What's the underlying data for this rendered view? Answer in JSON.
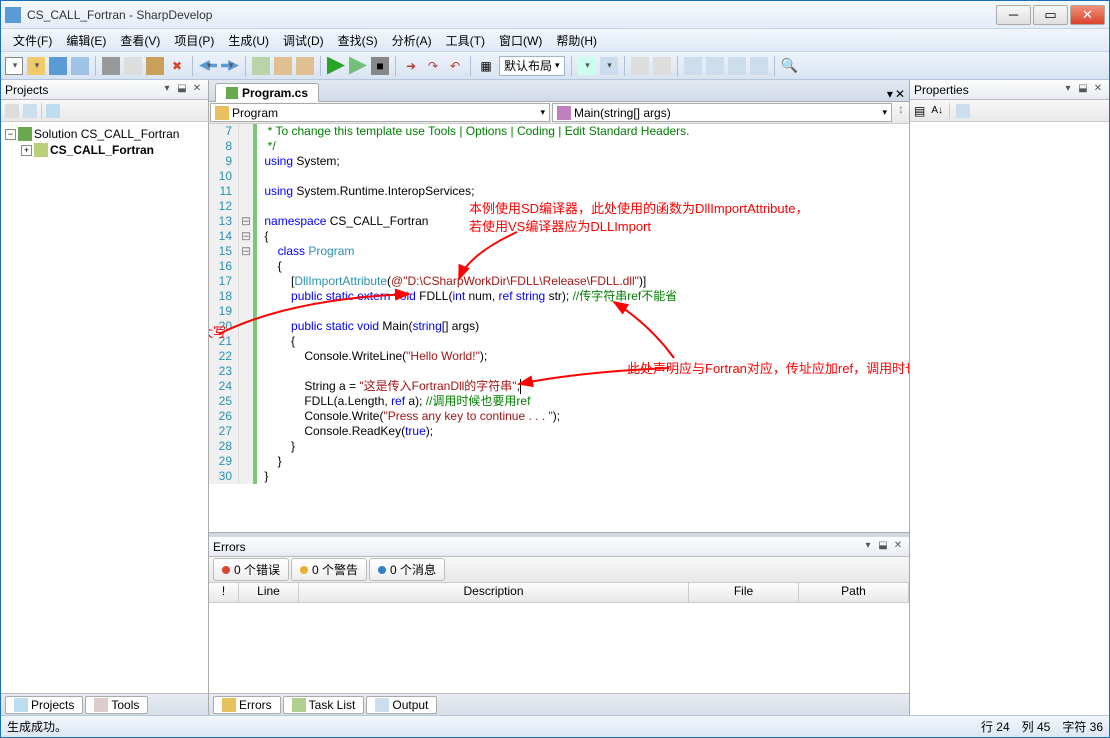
{
  "window": {
    "title": "CS_CALL_Fortran - SharpDevelop"
  },
  "menu": [
    "文件(F)",
    "编辑(E)",
    "查看(V)",
    "项目(P)",
    "生成(U)",
    "调试(D)",
    "查找(S)",
    "分析(A)",
    "工具(T)",
    "窗口(W)",
    "帮助(H)"
  ],
  "layout_combo": "默认布局",
  "projects": {
    "title": "Projects",
    "solution": "Solution CS_CALL_Fortran",
    "project": "CS_CALL_Fortran"
  },
  "tabs": {
    "active": "Program.cs",
    "nav_left": "Program",
    "nav_right": "Main(string[] args)"
  },
  "properties": {
    "title": "Properties"
  },
  "code": {
    "lines": [
      {
        "n": 7,
        "html": "  <span class='cmt'>* To change this template use Tools | Options | Coding | Edit Standard Headers.</span>"
      },
      {
        "n": 8,
        "html": "  <span class='cmt'>*/</span>"
      },
      {
        "n": 9,
        "html": " <span class='kw'>using</span> System;"
      },
      {
        "n": 10,
        "html": ""
      },
      {
        "n": 11,
        "html": " <span class='kw'>using</span> System.Runtime.InteropServices;"
      },
      {
        "n": 12,
        "html": ""
      },
      {
        "n": 13,
        "html": " <span class='kw'>namespace</span> CS_CALL_Fortran"
      },
      {
        "n": 14,
        "html": " {"
      },
      {
        "n": 15,
        "html": "     <span class='kw'>class</span> <span class='type'>Program</span>"
      },
      {
        "n": 16,
        "html": "     {"
      },
      {
        "n": 17,
        "html": "         [<span class='attr'>DllImportAttribute</span>(<span class='str'>@\"D:\\CSharpWorkDir\\FDLL\\Release\\FDLL.dll\"</span>)]"
      },
      {
        "n": 18,
        "html": "         <span class='kw'>public</span> <span class='kw'>static</span> <span class='kw'>extern</span> <span class='kw'>void</span> FDLL(<span class='kw'>int</span> num, <span class='kw'>ref</span> <span class='kw'>string</span> str); <span class='cmt'>//传字符串ref不能省</span>"
      },
      {
        "n": 19,
        "html": ""
      },
      {
        "n": 20,
        "html": "         <span class='kw'>public</span> <span class='kw'>static</span> <span class='kw'>void</span> Main(<span class='kw'>string</span>[] args)"
      },
      {
        "n": 21,
        "html": "         {"
      },
      {
        "n": 22,
        "html": "             Console.WriteLine(<span class='str'>\"Hello World!\"</span>);"
      },
      {
        "n": 23,
        "html": ""
      },
      {
        "n": 24,
        "html": "             String a = <span class='str'>\"这是传入FortranDll的字符串\"</span>;<span style='background:#000;width:1px;display:inline-block;'>&nbsp;</span>"
      },
      {
        "n": 25,
        "html": "             FDLL(a.Length, <span class='kw'>ref</span> a); <span class='cmt'>//调用时候也要用ref</span>"
      },
      {
        "n": 26,
        "html": "             Console.Write(<span class='str'>\"Press any key to continue . . . \"</span>);"
      },
      {
        "n": 27,
        "html": "             Console.ReadKey(<span class='kw'>true</span>);"
      },
      {
        "n": 28,
        "html": "         }"
      },
      {
        "n": 29,
        "html": "     }"
      },
      {
        "n": 30,
        "html": " }"
      }
    ]
  },
  "annotations": {
    "a1_l1": "本例使用SD编译器，此处使用的函数为DllImportAttribute，",
    "a1_l2": "若使用VS编译器应为DLLImport",
    "a2": "函数名一般为全大写",
    "a3": "此处声明应与Fortran对应，传址应加ref，调用时也应有ref"
  },
  "errors": {
    "title": "Errors",
    "tabs": {
      "err": "0 个错误",
      "warn": "0 个警告",
      "msg": "0 个消息"
    },
    "cols": {
      "bang": "!",
      "line": "Line",
      "desc": "Description",
      "file": "File",
      "path": "Path"
    }
  },
  "bottom_tabs_left": [
    "Projects",
    "Tools"
  ],
  "bottom_tabs_center": [
    "Errors",
    "Task List",
    "Output"
  ],
  "status": {
    "msg": "生成成功。",
    "line": "行 24",
    "col": "列 45",
    "char": "字符 36"
  }
}
